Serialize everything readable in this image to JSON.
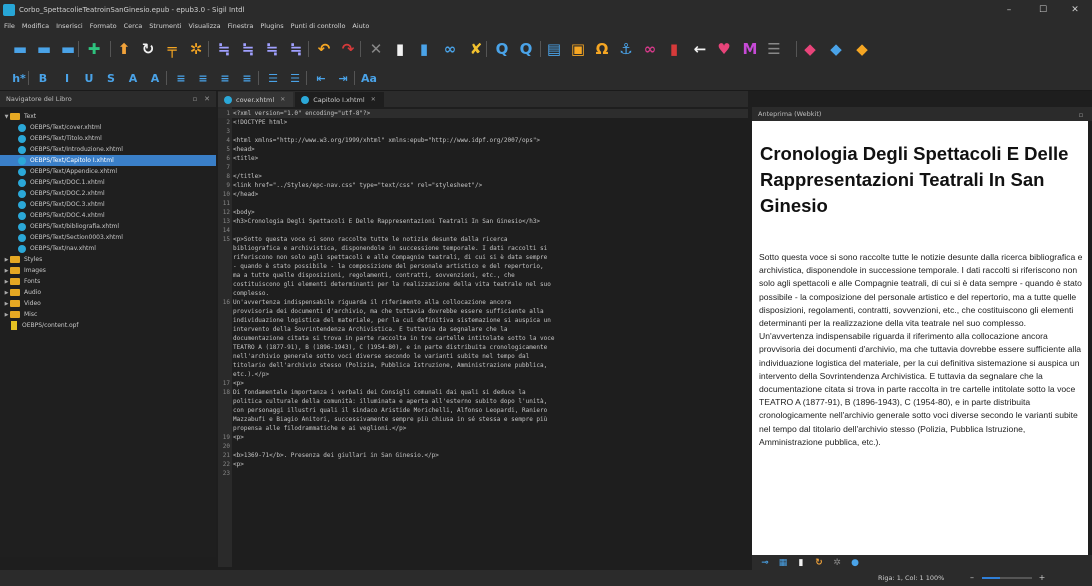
{
  "window": {
    "title": "Corbo_SpettacolieTeatroinSanGinesio.epub - epub3.0 - Sigil Intdl",
    "minimize": "–",
    "maximize": "☐",
    "close": "✕",
    "app_icon": "sigil-logo-icon"
  },
  "menubar": {
    "items": [
      "File",
      "Modifica",
      "Inserisci",
      "Formato",
      "Cerca",
      "Strumenti",
      "Visualizza",
      "Finestra",
      "Plugins",
      "Punti di controllo",
      "Aiuto"
    ]
  },
  "toolbar_main": {
    "icons": [
      {
        "name": "new-file-icon",
        "glyph": "▬",
        "color": "#4aa3e8"
      },
      {
        "name": "open-file-icon",
        "glyph": "▬",
        "color": "#4aa3e8"
      },
      {
        "name": "save-icon",
        "glyph": "▬",
        "color": "#4aa3e8"
      },
      {
        "name": "add-file-icon",
        "glyph": "✚",
        "color": "#2ec27e"
      },
      {
        "name": "arrow-up-icon",
        "glyph": "⬆",
        "color": "#f2a33a"
      },
      {
        "name": "refresh-icon",
        "glyph": "↻",
        "color": "#f2f2f2"
      },
      {
        "name": "split-icon",
        "glyph": "╤",
        "color": "#f5a623"
      },
      {
        "name": "gear-icon",
        "glyph": "✲",
        "color": "#f5a623"
      },
      {
        "name": "heading-up-icon",
        "glyph": "≒",
        "color": "#a0a0ff"
      },
      {
        "name": "heading-down-icon",
        "glyph": "≒",
        "color": "#a0a0ff"
      },
      {
        "name": "heading-remove-icon",
        "glyph": "≒",
        "color": "#a0a0ff"
      },
      {
        "name": "heading-clear-icon",
        "glyph": "≒",
        "color": "#a0a0ff"
      },
      {
        "name": "undo-icon",
        "glyph": "↶",
        "color": "#f5a623"
      },
      {
        "name": "redo-icon",
        "glyph": "↷",
        "color": "#d63a3a"
      },
      {
        "name": "cut-icon",
        "glyph": "✕",
        "color": "#888888"
      },
      {
        "name": "copy-icon",
        "glyph": "▮",
        "color": "#f2f2f2"
      },
      {
        "name": "paste-icon",
        "glyph": "▮",
        "color": "#4aa3e8"
      },
      {
        "name": "link-icon",
        "glyph": "∞",
        "color": "#4aa3e8"
      },
      {
        "name": "validate-icon",
        "glyph": "✘",
        "color": "#f2c12e"
      },
      {
        "name": "find-icon",
        "glyph": "Q",
        "color": "#4aa3e8"
      },
      {
        "name": "find-replace-icon",
        "glyph": "Q",
        "color": "#4aa3e8"
      },
      {
        "name": "toc-icon",
        "glyph": "▤",
        "color": "#4aa3e8"
      },
      {
        "name": "image-icon",
        "glyph": "▣",
        "color": "#f5a623"
      },
      {
        "name": "special-char-icon",
        "glyph": "Ω",
        "color": "#f5a623"
      },
      {
        "name": "anchor-icon",
        "glyph": "⚓",
        "color": "#4aa3e8"
      },
      {
        "name": "hyperlink-icon",
        "glyph": "∞",
        "color": "#d63a8a"
      },
      {
        "name": "bookmark-icon",
        "glyph": "▮",
        "color": "#d63a3a"
      },
      {
        "name": "back-icon",
        "glyph": "←",
        "color": "#f2f2f2"
      },
      {
        "name": "heart-icon",
        "glyph": "♥",
        "color": "#e8447a"
      },
      {
        "name": "metadata-icon",
        "glyph": "M",
        "color": "#c64ad6"
      },
      {
        "name": "list-icon",
        "glyph": "☰",
        "color": "#888888"
      },
      {
        "name": "plugin-a-icon",
        "glyph": "◆",
        "color": "#e8447a"
      },
      {
        "name": "plugin-b-icon",
        "glyph": "◆",
        "color": "#4aa3e8"
      },
      {
        "name": "plugin-c-icon",
        "glyph": "◆",
        "color": "#f5a623"
      }
    ]
  },
  "toolbar_format": {
    "icons": [
      {
        "name": "heading-level-icon",
        "glyph": "h*",
        "color": "#4aa3e8"
      },
      {
        "name": "bold-icon",
        "glyph": "B",
        "color": "#4aa3e8"
      },
      {
        "name": "italic-icon",
        "glyph": "I",
        "color": "#4aa3e8"
      },
      {
        "name": "underline-icon",
        "glyph": "U",
        "color": "#4aa3e8"
      },
      {
        "name": "strikethrough-icon",
        "glyph": "S",
        "color": "#4aa3e8"
      },
      {
        "name": "subscript-icon",
        "glyph": "A",
        "color": "#4aa3e8"
      },
      {
        "name": "superscript-icon",
        "glyph": "A",
        "color": "#4aa3e8"
      },
      {
        "name": "align-left-icon",
        "glyph": "≡",
        "color": "#4aa3e8"
      },
      {
        "name": "align-center-icon",
        "glyph": "≡",
        "color": "#4aa3e8"
      },
      {
        "name": "align-right-icon",
        "glyph": "≡",
        "color": "#4aa3e8"
      },
      {
        "name": "justify-icon",
        "glyph": "≡",
        "color": "#4aa3e8"
      },
      {
        "name": "bulleted-list-icon",
        "glyph": "☰",
        "color": "#4aa3e8"
      },
      {
        "name": "numbered-list-icon",
        "glyph": "☰",
        "color": "#4aa3e8"
      },
      {
        "name": "indent-decrease-icon",
        "glyph": "⇤",
        "color": "#4aa3e8"
      },
      {
        "name": "indent-increase-icon",
        "glyph": "⇥",
        "color": "#4aa3e8"
      },
      {
        "name": "case-icon",
        "glyph": "Aa",
        "color": "#4aa3e8"
      }
    ]
  },
  "book_browser": {
    "title": "Navigatore del Libro",
    "rows": [
      {
        "label": "Text",
        "kind": "folder",
        "indent": 0,
        "expanded": true
      },
      {
        "label": "OEBPS/Text/cover.xhtml",
        "kind": "file",
        "indent": 1
      },
      {
        "label": "OEBPS/Text/Titolo.xhtml",
        "kind": "file",
        "indent": 1
      },
      {
        "label": "OEBPS/Text/Introduzione.xhtml",
        "kind": "file",
        "indent": 1
      },
      {
        "label": "OEBPS/Text/Capitolo I.xhtml",
        "kind": "file",
        "indent": 1,
        "selected": true
      },
      {
        "label": "OEBPS/Text/Appendice.xhtml",
        "kind": "file",
        "indent": 1
      },
      {
        "label": "OEBPS/Text/DOC.1.xhtml",
        "kind": "file",
        "indent": 1
      },
      {
        "label": "OEBPS/Text/DOC.2.xhtml",
        "kind": "file",
        "indent": 1
      },
      {
        "label": "OEBPS/Text/DOC.3.xhtml",
        "kind": "file",
        "indent": 1
      },
      {
        "label": "OEBPS/Text/DOC.4.xhtml",
        "kind": "file",
        "indent": 1
      },
      {
        "label": "OEBPS/Text/bibliografia.xhtml",
        "kind": "file",
        "indent": 1
      },
      {
        "label": "OEBPS/Text/Section0003.xhtml",
        "kind": "file",
        "indent": 1
      },
      {
        "label": "OEBPS/Text/nav.xhtml",
        "kind": "file",
        "indent": 1
      },
      {
        "label": "Styles",
        "kind": "folder",
        "indent": 0
      },
      {
        "label": "Images",
        "kind": "folder",
        "indent": 0
      },
      {
        "label": "Fonts",
        "kind": "folder",
        "indent": 0
      },
      {
        "label": "Audio",
        "kind": "folder",
        "indent": 0
      },
      {
        "label": "Video",
        "kind": "folder",
        "indent": 0
      },
      {
        "label": "Misc",
        "kind": "folder",
        "indent": 0
      },
      {
        "label": "OEBPS/content.opf",
        "kind": "opf",
        "indent": 0
      }
    ]
  },
  "tabs": [
    {
      "label": "cover.xhtml",
      "active": false
    },
    {
      "label": "Capitolo I.xhtml",
      "active": true
    }
  ],
  "code": [
    {
      "n": "1",
      "text": "<?xml version=\"1.0\" encoding=\"utf-8\"?>"
    },
    {
      "n": "2",
      "text": "<!DOCTYPE html>"
    },
    {
      "n": "3",
      "text": ""
    },
    {
      "n": "4",
      "text": "<html xmlns=\"http://www.w3.org/1999/xhtml\" xmlns:epub=\"http://www.idpf.org/2007/ops\">"
    },
    {
      "n": "5",
      "text": "<head>"
    },
    {
      "n": "6",
      "text": "  <title>"
    },
    {
      "n": "7",
      "text": ""
    },
    {
      "n": "8",
      "text": "</title>"
    },
    {
      "n": "9",
      "text": "  <link href=\"../Styles/epc-nav.css\" type=\"text/css\" rel=\"stylesheet\"/>"
    },
    {
      "n": "10",
      "text": "</head>"
    },
    {
      "n": "11",
      "text": ""
    },
    {
      "n": "12",
      "text": "<body>"
    },
    {
      "n": "13",
      "text": "<h3>Cronologia Degli Spettacoli E Delle Rappresentazioni Teatrali In San Ginesio</h3>"
    },
    {
      "n": "14",
      "text": ""
    },
    {
      "n": "15",
      "text": "<p>Sotto questa voce si sono raccolte tutte le notizie desunte dalla ricerca"
    },
    {
      "n": "",
      "text": "bibliografica e archivistica, disponendole in successione temporale. I dati raccolti si"
    },
    {
      "n": "",
      "text": "riferiscono non solo agli spettacoli e alle Compagnie teatrali, di cui si è data sempre"
    },
    {
      "n": "",
      "text": "- quando è stato possibile - la composizione del personale artistico e del repertorio,"
    },
    {
      "n": "",
      "text": "ma a tutte quelle disposizioni, regolamenti, contratti, sovvenzioni, etc., che"
    },
    {
      "n": "",
      "text": "costituiscono gli elementi determinanti per la realizzazione della vita teatrale nel suo"
    },
    {
      "n": "",
      "text": "complesso."
    },
    {
      "n": "16",
      "text": "Un'avvertenza indispensabile riguarda il riferimento alla collocazione ancora"
    },
    {
      "n": "",
      "text": "provvisoria dei documenti d'archivio, ma che tuttavia dovrebbe essere sufficiente alla"
    },
    {
      "n": "",
      "text": "individuazione logistica del materiale, per la cui definitiva sistemazione si auspica un"
    },
    {
      "n": "",
      "text": "intervento della Sovrintendenza Archivistica. E tuttavia da segnalare che la"
    },
    {
      "n": "",
      "text": "documentazione citata si trova in parte raccolta in tre cartelle intitolate sotto la voce"
    },
    {
      "n": "",
      "text": "TEATRO A (1877-91), B (1896-1943), C (1954-80), e in parte distribuita cronologicamente"
    },
    {
      "n": "",
      "text": "nell'archivio generale sotto voci diverse secondo le varianti subite nel tempo dal"
    },
    {
      "n": "",
      "text": "titolario dell'archivio stesso (Polizia, Pubblica Istruzione, Amministrazione pubblica,"
    },
    {
      "n": "",
      "text": "etc.).</p>"
    },
    {
      "n": "17",
      "text": "  <p>"
    },
    {
      "n": "18",
      "text": "Di fondamentale importanza i verbali dei Consigli comunali dai quali si deduce la"
    },
    {
      "n": "",
      "text": "politica culturale della comunità: illuminata e aperta all'esterno subito dopo l'unità,"
    },
    {
      "n": "",
      "text": "con personaggi illustri quali il sindaco Aristide Morichelli, Alfonso Leopardi, Raniero"
    },
    {
      "n": "",
      "text": "Mazzabufi e Biagio Anitori, successivamente sempre più chiusa in sé stessa e sempre più"
    },
    {
      "n": "",
      "text": "propensa alle filodrammatiche e ai veglioni.</p>"
    },
    {
      "n": "19",
      "text": "  <p>"
    },
    {
      "n": "20",
      "text": ""
    },
    {
      "n": "21",
      "text": "<b>1369-71</b>. Presenza dei giullari in San Ginesio.</p>"
    },
    {
      "n": "22",
      "text": "  <p>"
    },
    {
      "n": "23",
      "text": ""
    }
  ],
  "preview": {
    "header": "Anteprima (Webkit)",
    "heading": "Cronologia Degli Spettacoli E Delle Rappresentazioni Teatrali In San Ginesio",
    "paragraph": "Sotto questa voce si sono raccolte tutte le notizie desunte dalla ricerca bibliografica e archivistica, disponendole in successione temporale. I dati raccolti si riferiscono non solo agli spettacoli e alle Compagnie teatrali, di cui si è data sempre - quando è stato possibile - la composizione del personale artistico e del repertorio, ma a tutte quelle disposizioni, regolamenti, contratti, sovvenzioni, etc., che costituiscono gli elementi determinanti per la realizzazione della vita teatrale nel suo complesso. Un'avvertenza indispensabile riguarda il riferimento alla collocazione ancora provvisoria dei documenti d'archivio, ma che tuttavia dovrebbe essere sufficiente alla individuazione logistica del materiale, per la cui definitiva sistemazione si auspica un intervento della Sovrintendenza Archivistica. E tuttavia da segnalare che la documentazione citata si trova in parte raccolta in tre cartelle intitolate sotto la voce TEATRO A (1877-91), B (1896-1943), C (1954-80), e in parte distribuita cronologicamente nell'archivio generale sotto voci diverse secondo le varianti subite nel tempo dal titolario dell'archivio stesso (Polizia, Pubblica Istruzione, Amministrazione pubblica, etc.).",
    "tools": [
      {
        "name": "inspect-icon",
        "glyph": "⊸",
        "color": "#4aa3e8"
      },
      {
        "name": "copy-view-icon",
        "glyph": "▦",
        "color": "#4aa3e8"
      },
      {
        "name": "file-view-icon",
        "glyph": "▮",
        "color": "#f2f2f2"
      },
      {
        "name": "reload-preview-icon",
        "glyph": "↻",
        "color": "#f2a33a"
      },
      {
        "name": "settings-preview-icon",
        "glyph": "✲",
        "color": "#888888"
      },
      {
        "name": "globe-preview-icon",
        "glyph": "●",
        "color": "#4aa3e8"
      }
    ]
  },
  "status": {
    "position": "Riga: 1, Col: 1",
    "zoom_label": "100%",
    "zoom_fraction": 0.35,
    "minus": "–",
    "plus": "+"
  }
}
